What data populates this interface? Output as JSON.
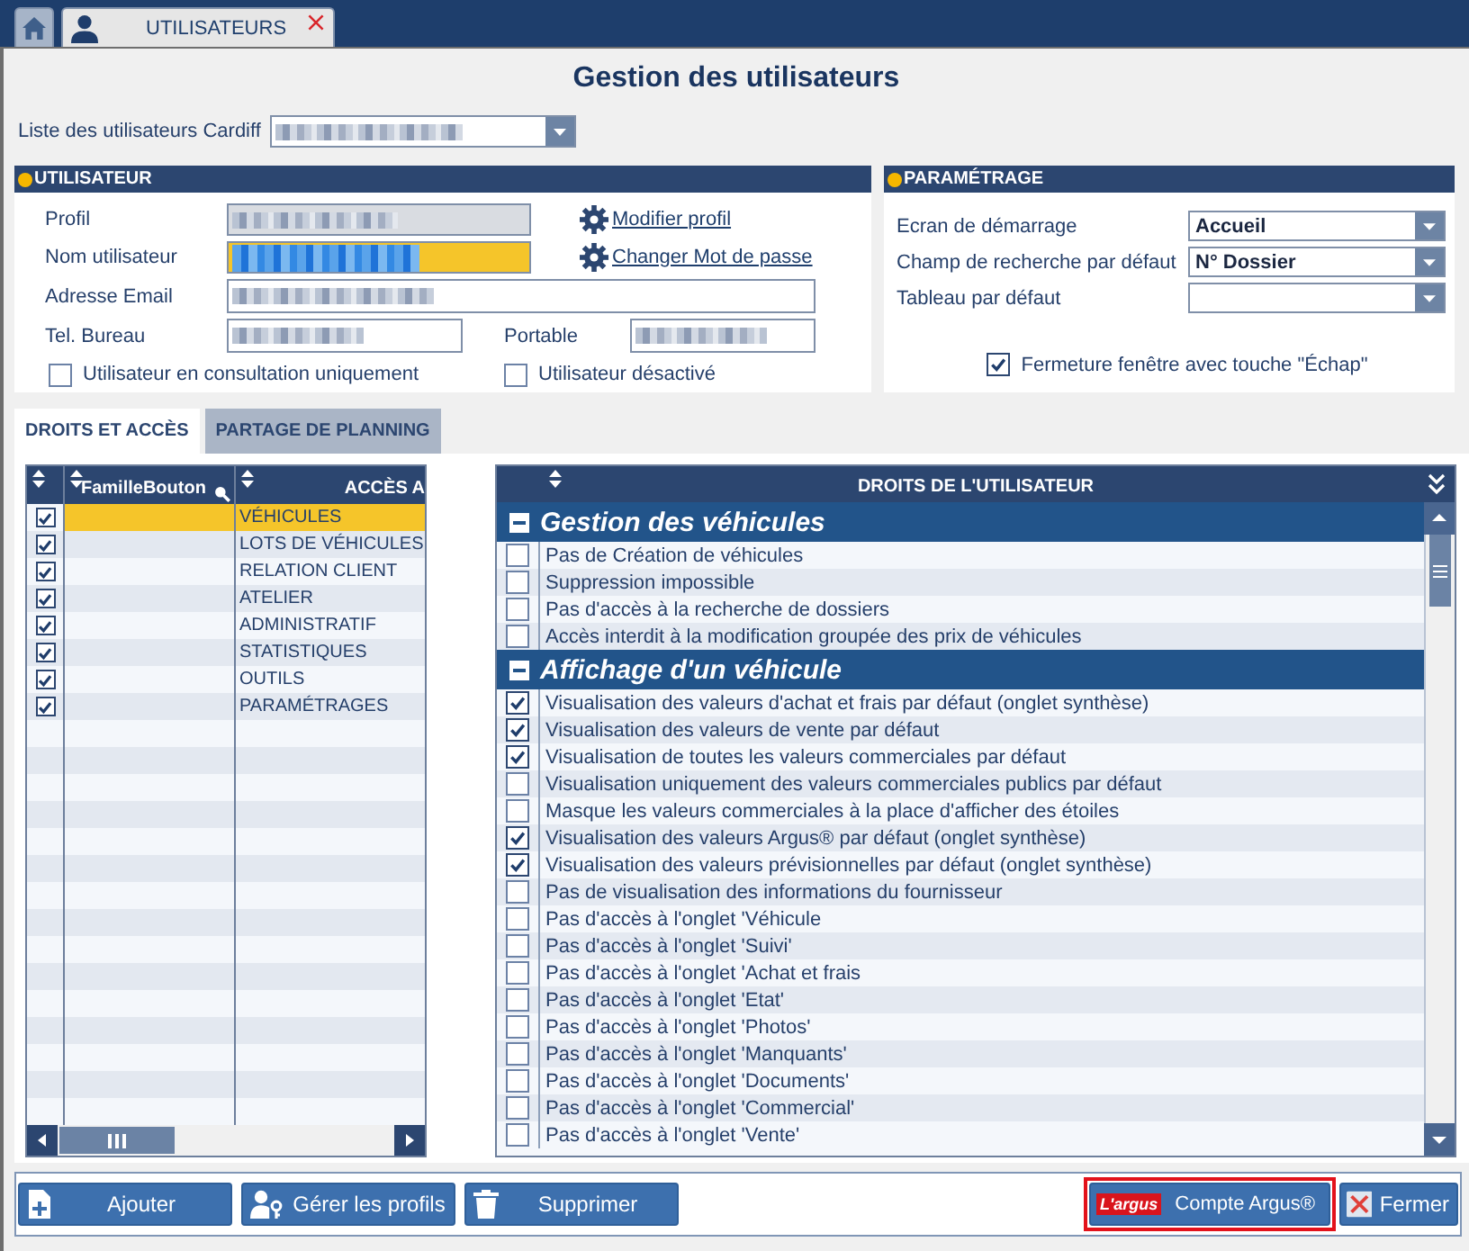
{
  "tabs": [
    {
      "kind": "home",
      "selected": false
    },
    {
      "kind": "users",
      "label": "UTILISATEURS",
      "selected": true,
      "closable": true
    }
  ],
  "title": "Gestion des utilisateurs",
  "user_list": {
    "label": "Liste des utilisateurs Cardiff",
    "redacted": true
  },
  "user_panel": {
    "title": "UTILISATEUR",
    "profile": {
      "label": "Profil",
      "redacted": true,
      "disabled": true
    },
    "username": {
      "label": "Nom utilisateur",
      "redacted": true,
      "focused": true
    },
    "links": [
      "Modifier profil",
      "Changer Mot de passe"
    ],
    "email": {
      "label": "Adresse Email",
      "redacted": true
    },
    "office_phone": {
      "label": "Tel. Bureau",
      "redacted": true
    },
    "mobile": {
      "label": "Portable",
      "redacted": true
    },
    "options": [
      {
        "label": "Utilisateur en consultation uniquement",
        "checked": false
      },
      {
        "label": "Utilisateur désactivé",
        "checked": false
      }
    ]
  },
  "settings_panel": {
    "title": "PARAMÉTRAGE",
    "selects": [
      {
        "label": "Ecran de démarrage",
        "value": "Accueil"
      },
      {
        "label": "Champ de recherche par défaut",
        "value": "N° Dossier"
      },
      {
        "label": "Tableau par défaut"
      }
    ],
    "option": {
      "label": "Fermeture fenêtre avec touche \"Échap\"",
      "checked": true
    }
  },
  "section_tabs": [
    {
      "label": "DROITS ET ACCÈS",
      "selected": true
    },
    {
      "label": "PARTAGE DE PLANNING",
      "selected": false
    }
  ],
  "access_grid": {
    "columns": [
      "FamilleBouton",
      "ACCÈS A"
    ],
    "rows": [
      {
        "label": "VÉHICULES",
        "checked": true,
        "selected": true
      },
      {
        "label": "LOTS DE VÉHICULES",
        "checked": true,
        "selected": false
      },
      {
        "label": "RELATION CLIENT",
        "checked": true,
        "selected": false
      },
      {
        "label": "ATELIER",
        "checked": true,
        "selected": false
      },
      {
        "label": "ADMINISTRATIF",
        "checked": true,
        "selected": false
      },
      {
        "label": "STATISTIQUES",
        "checked": true,
        "selected": false
      },
      {
        "label": "OUTILS",
        "checked": true,
        "selected": false
      },
      {
        "label": "PARAMÉTRAGES",
        "checked": true,
        "selected": false
      }
    ]
  },
  "rights_grid": {
    "title": "DROITS DE L'UTILISATEUR",
    "groups": [
      {
        "title": "Gestion des véhicules",
        "expanded": true,
        "items": [
          {
            "label": "Pas de Création de véhicules",
            "checked": false
          },
          {
            "label": "Suppression impossible",
            "checked": false
          },
          {
            "label": "Pas d'accès à la recherche de dossiers",
            "checked": false
          },
          {
            "label": "Accès interdit à la modification groupée des prix de véhicules",
            "checked": false
          }
        ]
      },
      {
        "title": "Affichage d'un véhicule",
        "expanded": true,
        "items": [
          {
            "label": "Visualisation des valeurs d'achat et frais par défaut (onglet synthèse)",
            "checked": true
          },
          {
            "label": "Visualisation des valeurs de vente par défaut",
            "checked": true
          },
          {
            "label": "Visualisation de toutes les valeurs commerciales par défaut",
            "checked": true
          },
          {
            "label": "Visualisation uniquement des valeurs commerciales publics par défaut",
            "checked": false
          },
          {
            "label": "Masque les valeurs commerciales à la place d'afficher des étoiles",
            "checked": false
          },
          {
            "label": "Visualisation des valeurs Argus® par défaut (onglet synthèse)",
            "checked": true
          },
          {
            "label": "Visualisation des valeurs prévisionnelles par défaut (onglet synthèse)",
            "checked": true
          },
          {
            "label": "Pas de visualisation des informations du fournisseur",
            "checked": false
          },
          {
            "label": "Pas d'accès à l'onglet 'Véhicule",
            "checked": false
          },
          {
            "label": "Pas d'accès à l'onglet 'Suivi'",
            "checked": false
          },
          {
            "label": "Pas d'accès à l'onglet 'Achat et frais",
            "checked": false
          },
          {
            "label": "Pas d'accès à l'onglet 'Etat'",
            "checked": false
          },
          {
            "label": "Pas d'accès à l'onglet 'Photos'",
            "checked": false
          },
          {
            "label": "Pas d'accès à l'onglet 'Manquants'",
            "checked": false
          },
          {
            "label": "Pas d'accès à l'onglet 'Documents'",
            "checked": false
          },
          {
            "label": "Pas d'accès à l'onglet 'Commercial'",
            "checked": false
          },
          {
            "label": "Pas d'accès à l'onglet 'Vente'",
            "checked": false
          }
        ]
      }
    ]
  },
  "footer": {
    "left_buttons": [
      {
        "kind": "add",
        "label": "Ajouter"
      },
      {
        "kind": "profiles",
        "label": "Gérer les profils"
      },
      {
        "kind": "delete",
        "label": "Supprimer"
      }
    ],
    "right_buttons": [
      {
        "kind": "argus",
        "logo": "L'argus",
        "label": "Compte Argus®",
        "highlighted": true
      },
      {
        "kind": "close",
        "label": "Fermer"
      }
    ]
  }
}
